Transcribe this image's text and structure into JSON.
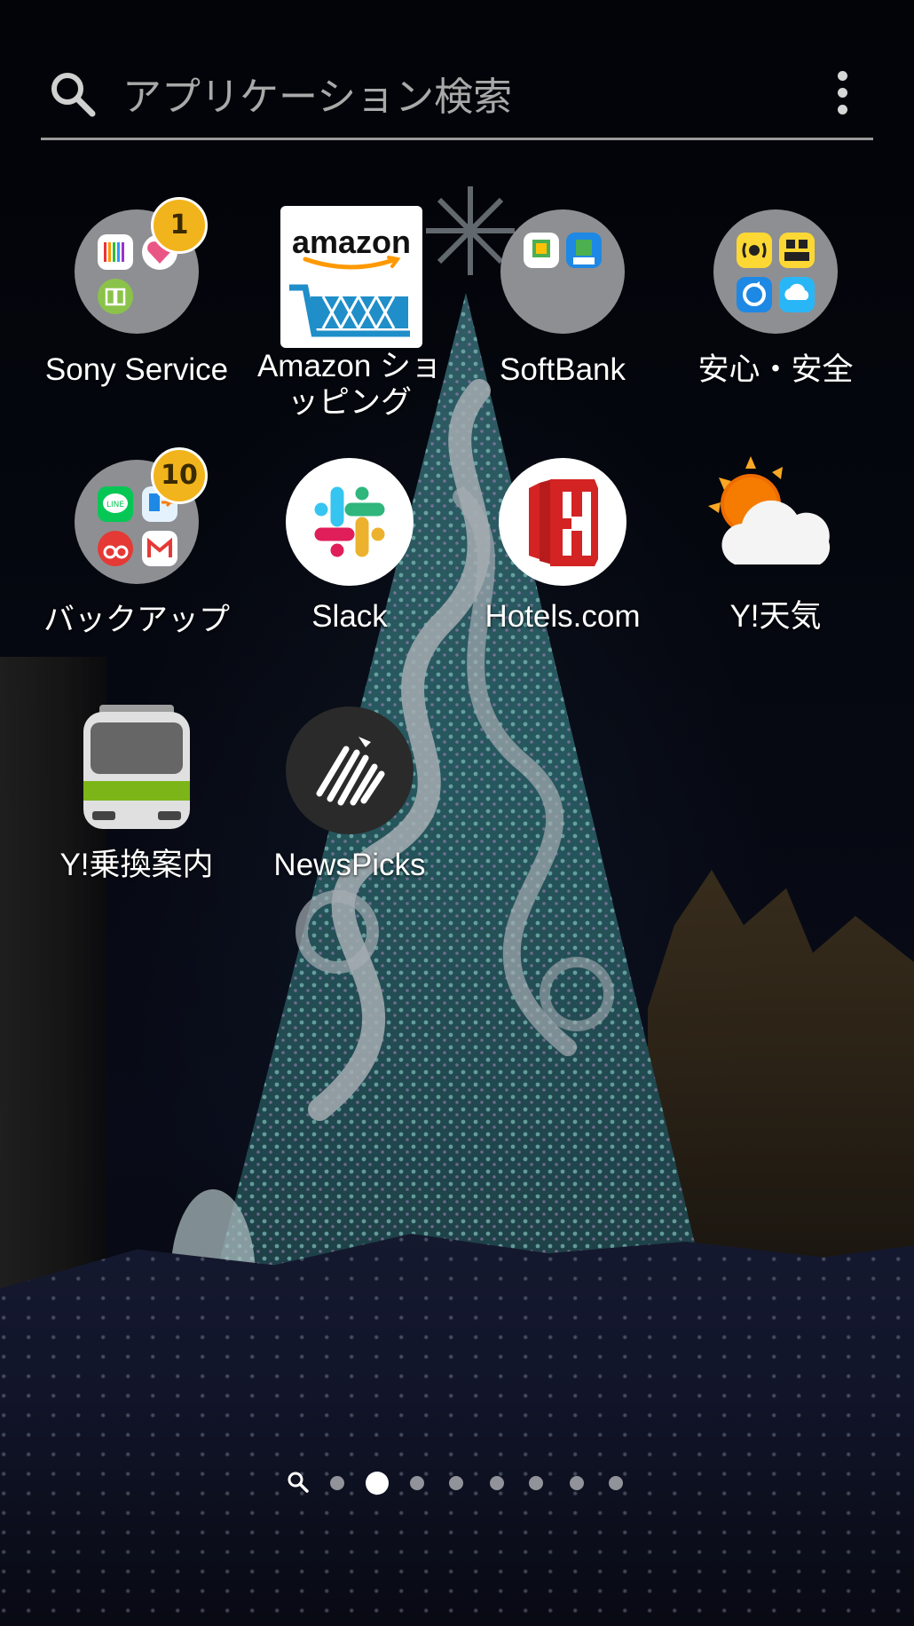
{
  "search": {
    "placeholder": "アプリケーション検索",
    "icon": "search-icon",
    "menu_icon": "more-vert-icon"
  },
  "apps": [
    {
      "label": "Sony Service",
      "type": "folder",
      "badge": "1"
    },
    {
      "label": "Amazon ショッピング",
      "type": "app",
      "icon": "amazon-cart-icon"
    },
    {
      "label": "SoftBank",
      "type": "folder"
    },
    {
      "label": "安心・安全",
      "type": "folder"
    },
    {
      "label": "バックアップ",
      "type": "folder",
      "badge": "10"
    },
    {
      "label": "Slack",
      "type": "app",
      "icon": "slack-icon"
    },
    {
      "label": "Hotels.com",
      "type": "app",
      "icon": "hotels-icon"
    },
    {
      "label": "Y!天気",
      "type": "app",
      "icon": "weather-icon"
    },
    {
      "label": "Y!乗換案内",
      "type": "app",
      "icon": "train-icon"
    },
    {
      "label": "NewsPicks",
      "type": "app",
      "icon": "zebra-icon"
    }
  ],
  "amazon_logo_text": "amazon",
  "page_indicator": {
    "pages": 8,
    "current": 2
  },
  "colors": {
    "badge": "#f2b41c",
    "folder": "#8e8f92",
    "hotels": "#d32323",
    "newspicks": "#2a2a2a"
  }
}
